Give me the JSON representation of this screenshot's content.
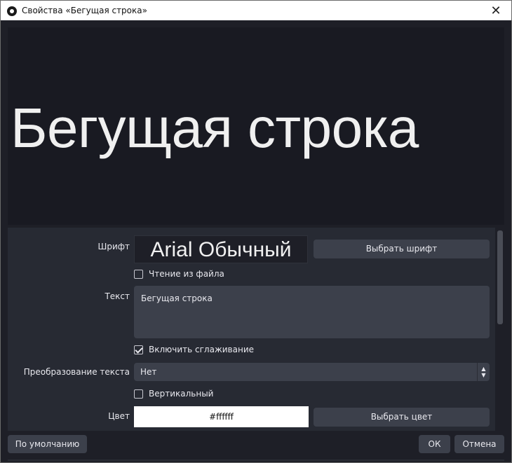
{
  "window": {
    "title": "Свойства «Бегущая строка»",
    "close_label": "✕"
  },
  "preview": {
    "text": "Бегущая строка"
  },
  "settings": {
    "font": {
      "label": "Шрифт",
      "display": "Arial Обычный",
      "choose_button": "Выбрать шрифт"
    },
    "read_from_file": {
      "label": "Чтение из файла",
      "checked": false
    },
    "text": {
      "label": "Текст",
      "value": "Бегущая строка"
    },
    "antialiasing": {
      "label": "Включить сглаживание",
      "checked": true
    },
    "text_transform": {
      "label": "Преобразование текста",
      "selected": "Нет"
    },
    "vertical": {
      "label": "Вертикальный",
      "checked": false
    },
    "color": {
      "label": "Цвет",
      "value": "#ffffff",
      "choose_button": "Выбрать цвет"
    }
  },
  "footer": {
    "defaults_button": "По умолчанию",
    "ok_button": "ОК",
    "cancel_button": "Отмена"
  },
  "colors": {
    "background": "#1e1f27",
    "panel": "#272a33",
    "control": "#3c404b",
    "text": "#e8e8ee"
  },
  "icons": {
    "app": "obs-logo-icon",
    "close": "close-icon",
    "check": "checkmark-icon",
    "select_arrows": "chevron-updown-icon"
  }
}
